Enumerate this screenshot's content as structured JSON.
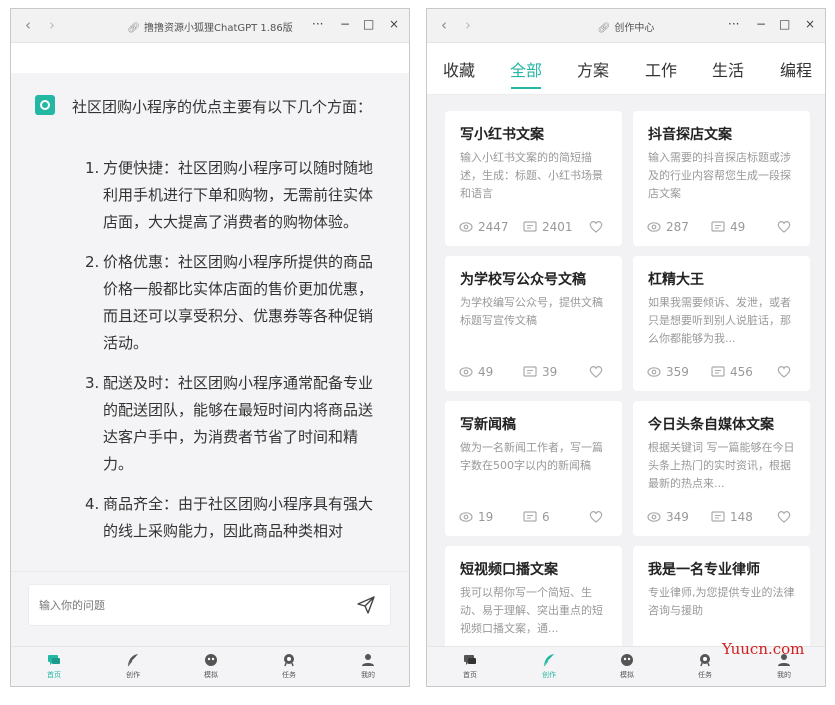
{
  "left_window": {
    "title": "撸撸资源小狐狸ChatGPT 1.86版",
    "controls": [
      "···",
      "−",
      "□",
      "×"
    ],
    "chat": {
      "intro": "社区团购小程序的优点主要有以下几个方面：",
      "points": [
        {
          "num": "1.",
          "text": "方便快捷：社区团购小程序可以随时随地利用手机进行下单和购物，无需前往实体店面，大大提高了消费者的购物体验。"
        },
        {
          "num": "2.",
          "text": "价格优惠：社区团购小程序所提供的商品价格一般都比实体店面的售价更加优惠，而且还可以享受积分、优惠券等各种促销活动。"
        },
        {
          "num": "3.",
          "text": "配送及时：社区团购小程序通常配备专业的配送团队，能够在最短时间内将商品送达客户手中，为消费者节省了时间和精力。"
        },
        {
          "num": "4.",
          "text": "商品齐全：由于社区团购小程序具有强大的线上采购能力，因此商品种类相对"
        }
      ]
    },
    "input": {
      "placeholder": "输入你的问题",
      "value": ""
    },
    "nav": [
      {
        "label": "首页",
        "icon": "chat-bubble-icon",
        "active": true
      },
      {
        "label": "创作",
        "icon": "feather-icon",
        "active": false
      },
      {
        "label": "模拟",
        "icon": "mask-icon",
        "active": false
      },
      {
        "label": "任务",
        "icon": "task-icon",
        "active": false
      },
      {
        "label": "我的",
        "icon": "user-icon",
        "active": false
      }
    ]
  },
  "right_window": {
    "title": "创作中心",
    "controls": [
      "···",
      "−",
      "□",
      "×"
    ],
    "tabs": [
      "收藏",
      "全部",
      "方案",
      "工作",
      "生活",
      "编程"
    ],
    "active_tab": "全部",
    "cards": [
      {
        "title": "写小红书文案",
        "desc": "输入小红书文案的的简短描述，生成：标题、小红书场景和语言",
        "views": "2447",
        "comments": "2401"
      },
      {
        "title": "抖音探店文案",
        "desc": "输入需要的抖音探店标题或涉及的行业内容帮您生成一段探店文案",
        "views": "287",
        "comments": "49"
      },
      {
        "title": "为学校写公众号文稿",
        "desc": "为学校编写公众号，提供文稿标题写宣传文稿",
        "views": "49",
        "comments": "39"
      },
      {
        "title": "杠精大王",
        "desc": "如果我需要倾诉、发泄，或者只是想要听到别人说脏话，那么你都能够为我...",
        "views": "359",
        "comments": "456"
      },
      {
        "title": "写新闻稿",
        "desc": "做为一名新闻工作者，写一篇字数在500字以内的新闻稿",
        "views": "19",
        "comments": "6"
      },
      {
        "title": "今日头条自媒体文案",
        "desc": "根据关键词 写一篇能够在今日头条上热门的实时资讯，根据最新的热点来...",
        "views": "349",
        "comments": "148"
      },
      {
        "title": "短视频口播文案",
        "desc": "我可以帮你写一个简短、生动、易于理解、突出重点的短视频口播文案，通...",
        "views": "",
        "comments": ""
      },
      {
        "title": "我是一名专业律师",
        "desc": "专业律师,为您提供专业的法律咨询与援助",
        "views": "",
        "comments": ""
      }
    ],
    "nav": [
      {
        "label": "首页",
        "icon": "chat-bubble-icon",
        "active": false
      },
      {
        "label": "创作",
        "icon": "feather-icon",
        "active": true
      },
      {
        "label": "模拟",
        "icon": "mask-icon",
        "active": false
      },
      {
        "label": "任务",
        "icon": "task-icon",
        "active": false
      },
      {
        "label": "我的",
        "icon": "user-icon",
        "active": false
      }
    ]
  },
  "watermark": "Yuucn.com",
  "colors": {
    "accent": "#24b7a4",
    "watermark": "#d02020"
  }
}
